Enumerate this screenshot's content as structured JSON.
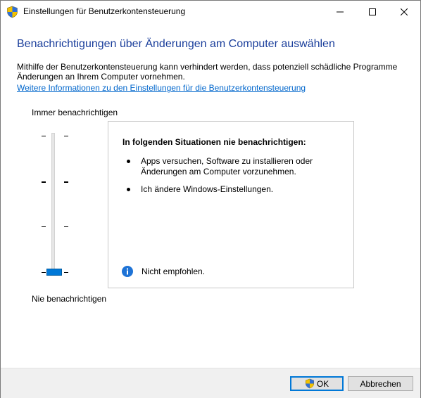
{
  "window": {
    "title": "Einstellungen für Benutzerkontensteuerung"
  },
  "content": {
    "heading": "Benachrichtigungen über Änderungen am Computer auswählen",
    "description": "Mithilfe der Benutzerkontensteuerung kann verhindert werden, dass potenziell schädliche Programme Änderungen an Ihrem Computer vornehmen.",
    "link": "Weitere Informationen zu den Einstellungen für die Benutzerkontensteuerung"
  },
  "slider": {
    "label_top": "Immer benachrichtigen",
    "label_bottom": "Nie benachrichtigen",
    "levels": 4,
    "selected_level": 1
  },
  "panel": {
    "title": "In folgenden Situationen nie benachrichtigen:",
    "bullets": [
      "Apps versuchen, Software zu installieren oder Änderungen am Computer vorzunehmen.",
      "Ich ändere Windows-Einstellungen."
    ],
    "info": "Nicht empfohlen."
  },
  "buttons": {
    "ok": "OK",
    "cancel": "Abbrechen"
  },
  "colors": {
    "heading": "#1a3e9b",
    "link": "#0066cc",
    "accent": "#0078d7"
  },
  "icons": {
    "title": "uac-shield-icon",
    "ok": "uac-shield-icon",
    "info": "info-icon"
  }
}
